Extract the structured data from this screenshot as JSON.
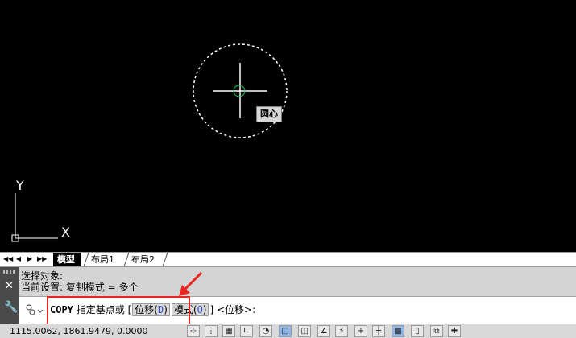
{
  "canvas": {
    "tooltip": "圆心",
    "ucs_x": "X",
    "ucs_y": "Y"
  },
  "tabs": {
    "nav": [
      "◀◀",
      "◀",
      "▶",
      "▶▶"
    ],
    "items": [
      {
        "label": "模型",
        "active": true
      },
      {
        "label": "布局1",
        "active": false
      },
      {
        "label": "布局2",
        "active": false
      }
    ]
  },
  "command": {
    "history": [
      "选择对象:",
      "当前设置:   复制模式 = 多个"
    ],
    "prompt": {
      "name": "COPY",
      "text1": "指定基点或",
      "open_bracket": "[",
      "opt1_label": "位移(",
      "opt1_key": "D",
      "opt1_close": ")",
      "opt2_label": "模式(",
      "opt2_key": "O",
      "opt2_close": ")",
      "close_bracket": "]",
      "default": "<位移>:"
    }
  },
  "status": {
    "coords": "1115.0062,  1861.9479,  0.0000"
  },
  "colors": {
    "canvas": "#000000",
    "highlight": "#e6261f",
    "option_key": "#2a4bd6",
    "cursor_circle": "#22c55e"
  }
}
